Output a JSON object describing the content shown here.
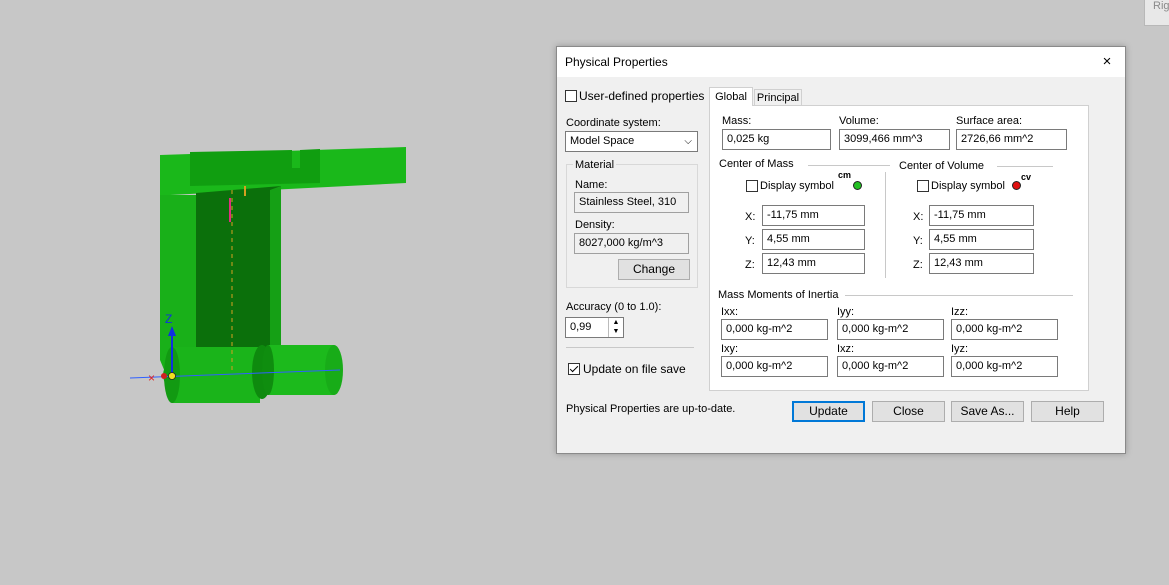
{
  "corner_text": "Rig",
  "dialog": {
    "title": "Physical Properties",
    "close_icon": "×",
    "user_defined_label": "User-defined properties",
    "coordinate_system_label": "Coordinate system:",
    "coordinate_system_value": "Model Space",
    "material": {
      "group_label": "Material",
      "name_label": "Name:",
      "name_value": "Stainless Steel, 310",
      "density_label": "Density:",
      "density_value": "8027,000 kg/m^3",
      "change_label": "Change"
    },
    "accuracy_label": "Accuracy (0 to 1.0):",
    "accuracy_value": "0,99",
    "update_on_save_label": "Update on file save",
    "status_text": "Physical Properties are up-to-date.",
    "tabs": {
      "global": "Global",
      "principal": "Principal"
    },
    "global": {
      "mass_label": "Mass:",
      "mass_value": "0,025 kg",
      "volume_label": "Volume:",
      "volume_value": "3099,466 mm^3",
      "surface_label": "Surface area:",
      "surface_value": "2726,66 mm^2",
      "com": {
        "header": "Center of Mass",
        "display_label": "Display symbol",
        "symbol_text": "cm",
        "symbol_color": "#22c022",
        "x_label": "X:",
        "x_value": "-11,75 mm",
        "y_label": "Y:",
        "y_value": "4,55 mm",
        "z_label": "Z:",
        "z_value": "12,43 mm"
      },
      "cov": {
        "header": "Center of Volume",
        "display_label": "Display symbol",
        "symbol_text": "cv",
        "symbol_color": "#e01010",
        "x_label": "X:",
        "x_value": "-11,75 mm",
        "y_label": "Y:",
        "y_value": "4,55 mm",
        "z_label": "Z:",
        "z_value": "12,43 mm"
      },
      "moi": {
        "header": "Mass Moments of Inertia",
        "ixx_label": "Ixx:",
        "ixx_value": "0,000 kg-m^2",
        "iyy_label": "Iyy:",
        "iyy_value": "0,000 kg-m^2",
        "izz_label": "Izz:",
        "izz_value": "0,000 kg-m^2",
        "ixy_label": "Ixy:",
        "ixy_value": "0,000 kg-m^2",
        "ixz_label": "Ixz:",
        "ixz_value": "0,000 kg-m^2",
        "iyz_label": "Iyz:",
        "iyz_value": "0,000 kg-m^2"
      }
    },
    "buttons": {
      "update": "Update",
      "close": "Close",
      "save_as": "Save As...",
      "help": "Help"
    }
  },
  "viewport": {
    "axis_z_label": "Z",
    "model_color": "#1fb81f",
    "model_dark_color": "#0d7a0d"
  }
}
